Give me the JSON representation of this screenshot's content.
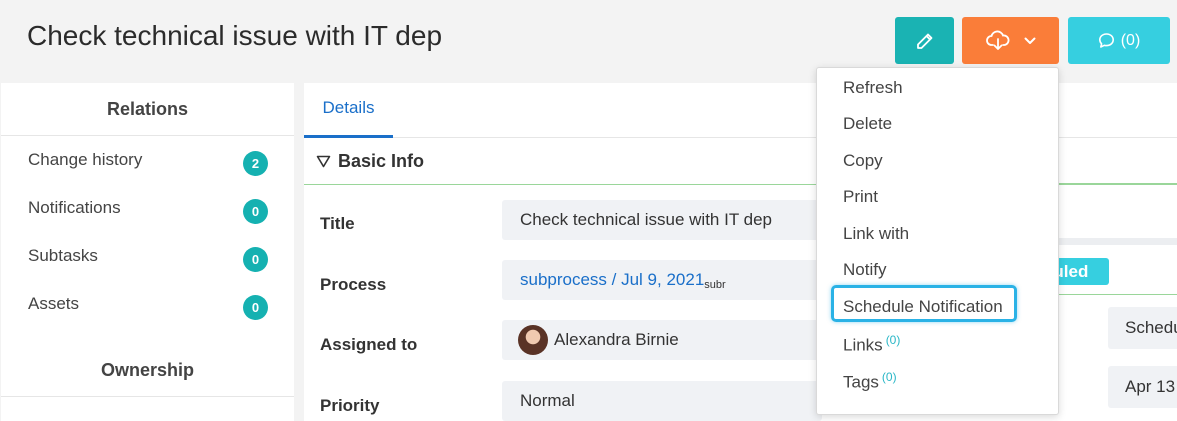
{
  "page": {
    "title": "Check technical issue with IT dep"
  },
  "toolbar": {
    "comments_label": "(0)",
    "colors": {
      "edit": "#1ab3b3",
      "download": "#fa7d39",
      "comments": "#36cfe0"
    }
  },
  "relations": {
    "heading": "Relations",
    "items": [
      {
        "label": "Change history",
        "count": "2"
      },
      {
        "label": "Notifications",
        "count": "0"
      },
      {
        "label": "Subtasks",
        "count": "0"
      },
      {
        "label": "Assets",
        "count": "0"
      }
    ],
    "ownership_heading": "Ownership"
  },
  "details": {
    "tab_label": "Details",
    "section_title": "Basic Info",
    "fields": {
      "title": {
        "label": "Title",
        "value": "Check technical issue with IT dep"
      },
      "process": {
        "label": "Process",
        "value": "subprocess / Jul 9, 2021",
        "suffix": "subr"
      },
      "assigned_to": {
        "label": "Assigned to",
        "value": "Alexandra Birnie"
      },
      "priority": {
        "label": "Priority",
        "value": "Normal"
      }
    },
    "right": {
      "status": "Scheduled",
      "status_visible": "duled",
      "box1": "Schedu",
      "box2": "Apr 13"
    }
  },
  "menu": {
    "items": [
      {
        "label": "Refresh"
      },
      {
        "label": "Delete"
      },
      {
        "label": "Copy"
      },
      {
        "label": "Print"
      },
      {
        "label": "Link with"
      },
      {
        "label": "Notify"
      },
      {
        "label": "Schedule Notification",
        "highlighted": true
      },
      {
        "label": "Links",
        "count": "(0)"
      },
      {
        "label": "Tags",
        "count": "(0)"
      }
    ]
  }
}
